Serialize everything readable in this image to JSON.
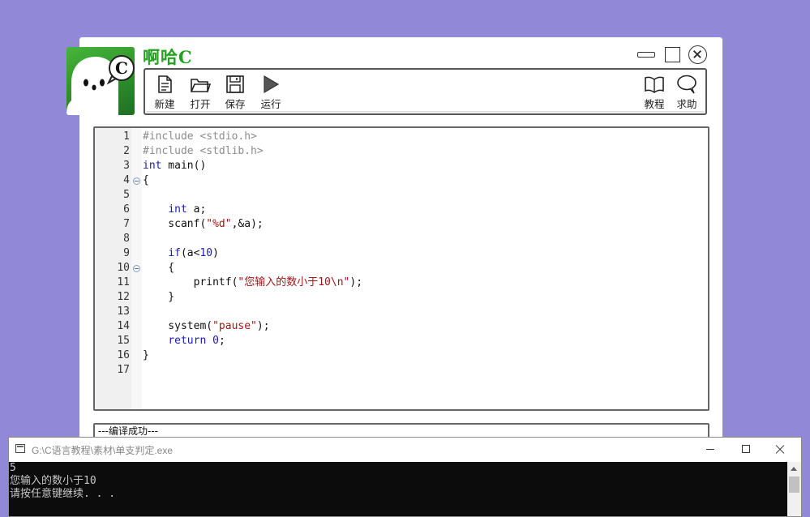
{
  "ide": {
    "title": "啊哈C",
    "toolbar": {
      "new": "新建",
      "open": "打开",
      "save": "保存",
      "run": "运行",
      "tutorial": "教程",
      "help": "求助"
    },
    "status": "---编译成功---"
  },
  "code": {
    "lines": [
      {
        "n": "1",
        "t": "#include <stdio.h>"
      },
      {
        "n": "2",
        "t": "#include <stdlib.h>"
      },
      {
        "n": "3",
        "t": "int main()"
      },
      {
        "n": "4",
        "t": "{"
      },
      {
        "n": "5",
        "t": ""
      },
      {
        "n": "6",
        "t": "    int a;"
      },
      {
        "n": "7",
        "t": "    scanf(\"%d\",&a);"
      },
      {
        "n": "8",
        "t": ""
      },
      {
        "n": "9",
        "t": "    if(a<10)"
      },
      {
        "n": "10",
        "t": "    {"
      },
      {
        "n": "11",
        "t": "        printf(\"您输入的数小于10\\n\");"
      },
      {
        "n": "12",
        "t": "    }"
      },
      {
        "n": "13",
        "t": ""
      },
      {
        "n": "14",
        "t": "    system(\"pause\");"
      },
      {
        "n": "15",
        "t": "    return 0;"
      },
      {
        "n": "16",
        "t": "}"
      },
      {
        "n": "17",
        "t": ""
      }
    ]
  },
  "console": {
    "title": "G:\\C语言教程\\素材\\单支判定.exe",
    "output": [
      "5",
      "您输入的数小于10",
      "请按任意键继续. . ."
    ]
  },
  "colors": {
    "desktop": "#9189d8",
    "keyword": "#1a1aa6",
    "string": "#a31515",
    "preprocessor": "#8c8c8c",
    "brand_green": "#23a31f"
  }
}
